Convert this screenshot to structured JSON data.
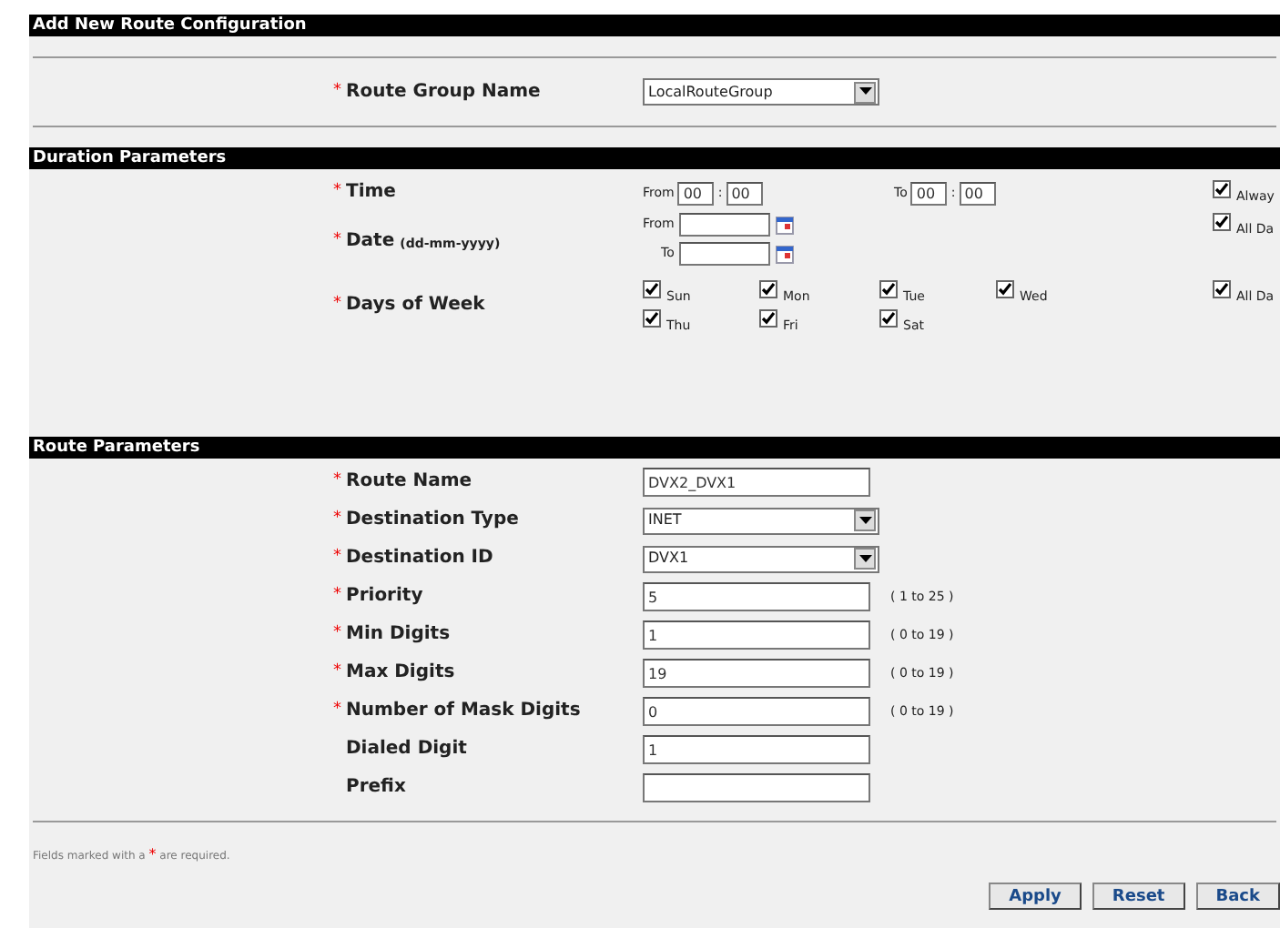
{
  "title": "Add New Route Configuration",
  "route_group": {
    "label": "Route Group Name",
    "required": true,
    "kind": "select",
    "value": "LocalRouteGroup"
  },
  "duration": {
    "title": "Duration Parameters",
    "time": {
      "label": "Time",
      "required": true,
      "from_label": "From",
      "from_hour": "00",
      "from_minute": "00",
      "to_label": "To",
      "to_hour": "00",
      "to_minute": "00",
      "separator": ":",
      "option": {
        "label": "Alway",
        "checked": true
      }
    },
    "date": {
      "label": "Date",
      "hint": "(dd-mm-yyyy)",
      "required": true,
      "from_label": "From",
      "to_label": "To",
      "option": {
        "label": "All Da",
        "checked": true
      }
    },
    "days": {
      "label": "Days of Week",
      "required": true,
      "items": [
        {
          "label": "Sun",
          "checked": true
        },
        {
          "label": "Mon",
          "checked": true
        },
        {
          "label": "Tue",
          "checked": true
        },
        {
          "label": "Wed",
          "checked": true
        },
        {
          "label": "Thu",
          "checked": true
        },
        {
          "label": "Fri",
          "checked": true
        },
        {
          "label": "Sat",
          "checked": true
        }
      ],
      "option": {
        "label": "All Da",
        "checked": true
      }
    }
  },
  "route": {
    "title": "Route Parameters",
    "fields": [
      {
        "label": "Route Name",
        "required": true,
        "kind": "text",
        "value": "DVX2_DVX1"
      },
      {
        "label": "Destination Type",
        "required": true,
        "kind": "select",
        "value": "INET"
      },
      {
        "label": "Destination ID",
        "required": true,
        "kind": "select",
        "value": "DVX1"
      },
      {
        "label": "Priority",
        "required": true,
        "kind": "text",
        "value": "5",
        "range": "( 1 to 25 )"
      },
      {
        "label": "Min Digits",
        "required": true,
        "kind": "text",
        "value": "1",
        "range": "( 0 to 19 )"
      },
      {
        "label": "Max Digits",
        "required": true,
        "kind": "text",
        "value": "19",
        "range": "( 0 to 19 )"
      },
      {
        "label": "Number of Mask Digits",
        "required": true,
        "kind": "text",
        "value": "0",
        "range": "( 0 to 19 )"
      },
      {
        "label": "Dialed Digit",
        "required": false,
        "kind": "text",
        "value": "1"
      },
      {
        "label": "Prefix",
        "required": false,
        "kind": "text"
      }
    ]
  },
  "footnote": {
    "before": "Fields marked with a",
    "mark": "*",
    "after": "are required."
  },
  "buttons": [
    "Apply",
    "Reset",
    "Back"
  ]
}
